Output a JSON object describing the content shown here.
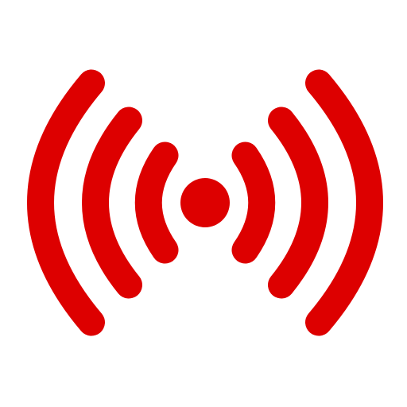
{
  "icon": {
    "name": "broadcast-signal-icon",
    "color": "#dd0000",
    "background": "#ffffff",
    "wave_rings_per_side": 3
  }
}
